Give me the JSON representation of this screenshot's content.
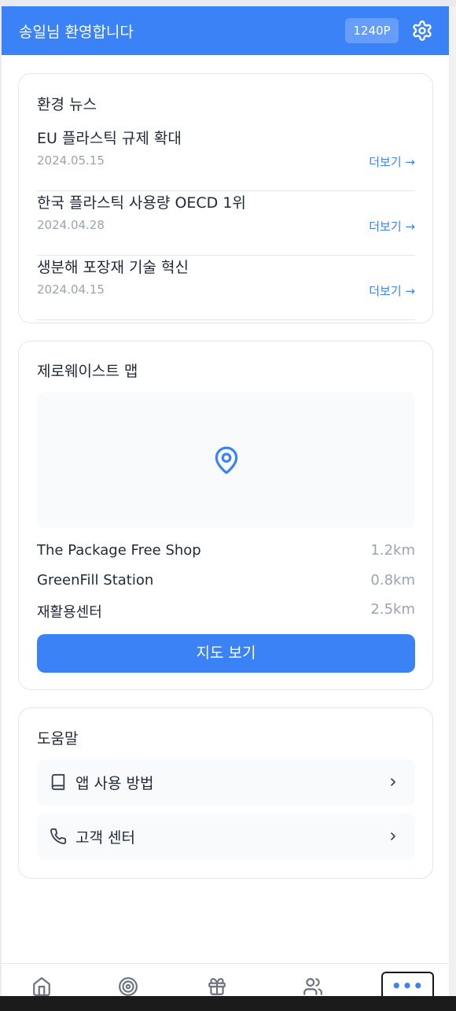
{
  "header": {
    "greeting": "송일님 환영합니다",
    "points": "1240P",
    "settings_icon": "gear-icon"
  },
  "news": {
    "title": "환경 뉴스",
    "items": [
      {
        "headline": "EU 플라스틱 규제 확대",
        "date": "2024.05.15",
        "more": "더보기 →"
      },
      {
        "headline": "한국 플라스틱 사용량 OECD 1위",
        "date": "2024.04.28",
        "more": "더보기 →"
      },
      {
        "headline": "생분해 포장재 기술 혁신",
        "date": "2024.04.15",
        "more": "더보기 →"
      }
    ]
  },
  "map": {
    "title": "제로웨이스트 맵",
    "pin_icon": "map-pin-icon",
    "places": [
      {
        "name": "The Package Free Shop",
        "distance": "1.2km"
      },
      {
        "name": "GreenFill Station",
        "distance": "0.8km"
      },
      {
        "name": "재활용센터",
        "distance": "2.5km"
      }
    ],
    "button_label": "지도 보기"
  },
  "help": {
    "title": "도움말",
    "items": [
      {
        "label": "앱 사용 방법",
        "icon": "book-icon"
      },
      {
        "label": "고객 센터",
        "icon": "phone-icon"
      }
    ]
  },
  "bottom_nav": {
    "items": [
      "home-icon",
      "target-icon",
      "gift-icon",
      "users-icon",
      "more-icon"
    ],
    "more_label": "•••"
  },
  "colors": {
    "accent": "#3b82f6",
    "muted": "#9ca3af",
    "card_border": "#e5e7eb",
    "panel_bg": "#f8fafc"
  }
}
